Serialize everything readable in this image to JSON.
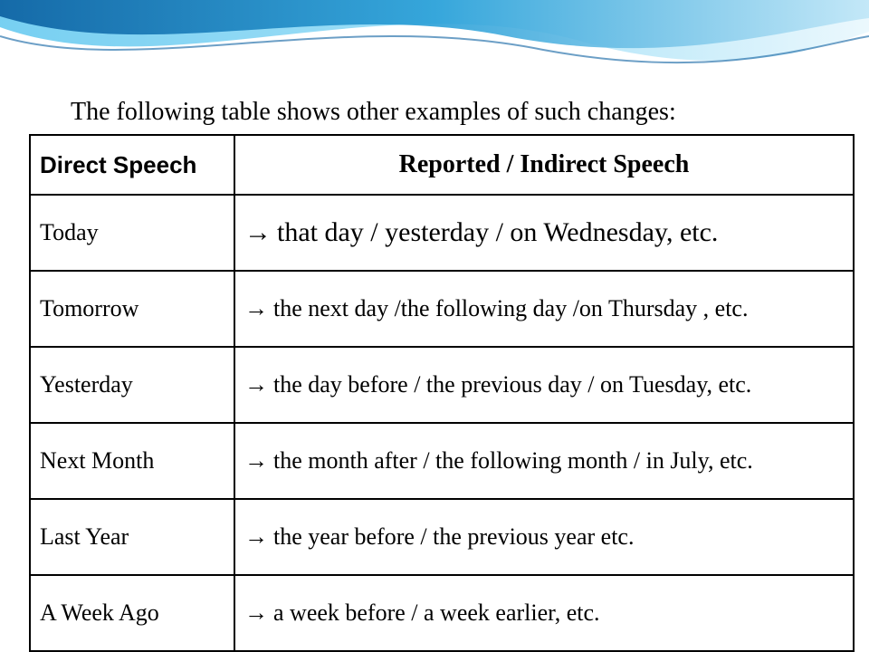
{
  "intro": "The following table shows other examples of such changes:",
  "headers": {
    "direct": "Direct Speech",
    "reported": "Reported / Indirect Speech"
  },
  "arrow": "→",
  "rows": [
    {
      "direct": "Today",
      "reported": "that day / yesterday / on Wednesday, etc."
    },
    {
      "direct": "Tomorrow",
      "reported": "the next day /the following day /on Thursday , etc."
    },
    {
      "direct": "Yesterday",
      "reported": "the day before / the previous day / on Tuesday, etc."
    },
    {
      "direct": "Next Month",
      "reported": "the month after / the following month / in July, etc."
    },
    {
      "direct": "Last Year",
      "reported": "the year before / the previous year etc."
    },
    {
      "direct": "A Week Ago",
      "reported": "a week before / a week earlier, etc."
    }
  ]
}
